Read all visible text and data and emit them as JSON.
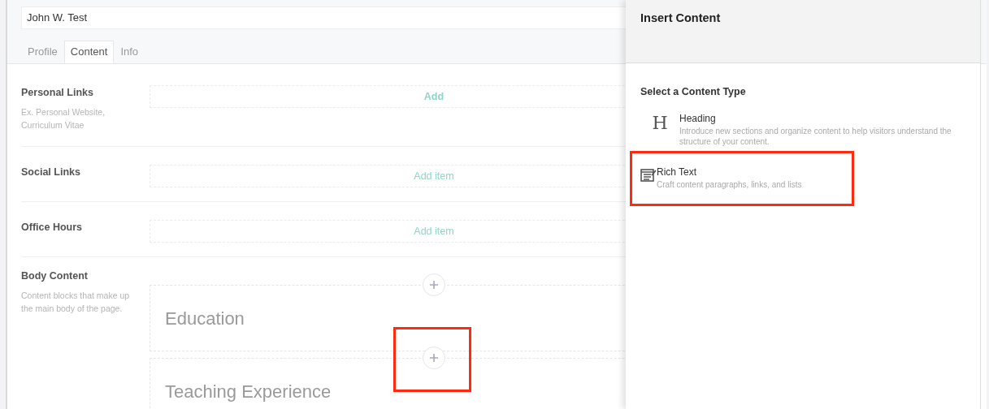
{
  "name_field": {
    "value": "John W. Test"
  },
  "tabs": [
    {
      "label": "Profile",
      "selected": false
    },
    {
      "label": "Content",
      "selected": true
    },
    {
      "label": "Info",
      "selected": false
    }
  ],
  "fields": [
    {
      "label": "Personal Links",
      "hint": "Ex. Personal Website, Curriculum Vitae",
      "action": "Add",
      "kind": "bold"
    },
    {
      "label": "Social Links",
      "action": "Add item",
      "kind": "plain"
    },
    {
      "label": "Office Hours",
      "action": "Add item",
      "kind": "plain"
    }
  ],
  "body_content": {
    "label": "Body Content",
    "hint": "Content blocks that make up the main body of the page.",
    "blocks": [
      "Education",
      "Teaching Experience"
    ]
  },
  "drawer": {
    "title": "Insert Content",
    "subtitle": "Select a Content Type",
    "types": [
      {
        "kind": "heading",
        "name": "Heading",
        "description": "Introduce new sections and organize content to help visitors understand the structure of your content.",
        "highlighted": false,
        "glyph": "H"
      },
      {
        "kind": "richtext",
        "name": "Rich Text",
        "description": "Craft content paragraphs, links, and lists",
        "highlighted": true
      }
    ]
  }
}
